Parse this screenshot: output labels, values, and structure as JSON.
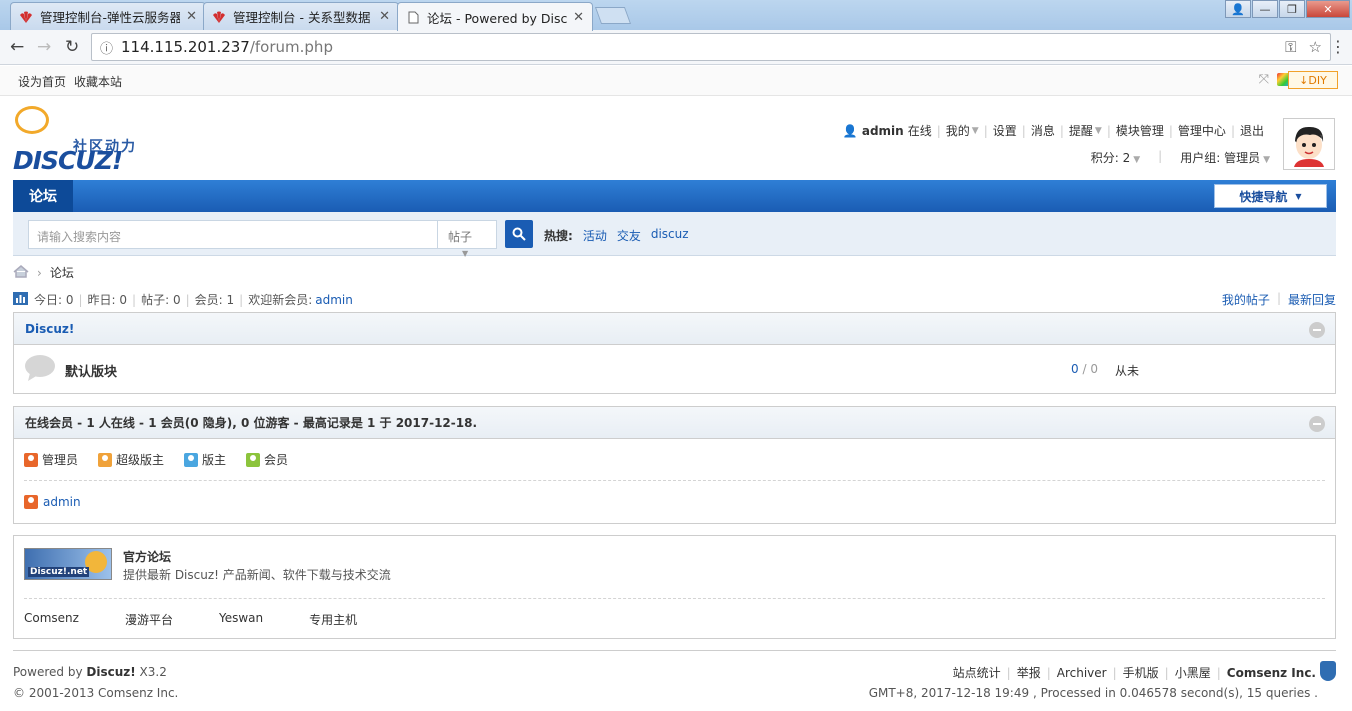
{
  "browser": {
    "tabs": [
      {
        "title": "管理控制台-弹性云服务器",
        "close": "✕"
      },
      {
        "title": "管理控制台 - 关系型数据",
        "close": "✕"
      },
      {
        "title": "论坛 - Powered by Disc",
        "close": "✕"
      }
    ],
    "url_host": "114.115.201.237",
    "url_path": "/forum.php"
  },
  "topbar": {
    "set_home": "设为首页",
    "bookmark": "收藏本站",
    "diy": "DIY"
  },
  "logo": {
    "tagline": "社区动力",
    "wordmark": "DISCUZ!"
  },
  "user": {
    "name": "admin",
    "status": "在线",
    "mine": "我的",
    "settings": "设置",
    "messages": "消息",
    "remind": "提醒",
    "module": "模块管理",
    "admin_center": "管理中心",
    "logout": "退出",
    "points": "积分: 2",
    "usergroup": "用户组: 管理员"
  },
  "nav": {
    "current": "论坛",
    "quick_nav": "快捷导航"
  },
  "search": {
    "placeholder": "请输入搜索内容",
    "type": "帖子",
    "hot_label": "热搜:",
    "hot": [
      "活动",
      "交友",
      "discuz"
    ]
  },
  "crumb": {
    "current": "论坛"
  },
  "stats": {
    "today": "今日: 0",
    "yesterday": "昨日: 0",
    "posts": "帖子: 0",
    "members": "会员: 1",
    "welcome": "欢迎新会员: ",
    "newest": "admin",
    "my_posts": "我的帖子",
    "latest_reply": "最新回复"
  },
  "category": {
    "title": "Discuz!",
    "forum_name": "默认版块",
    "threads": "0",
    "posts": "0",
    "last_post": "从未"
  },
  "online": {
    "title": "在线会员 - 1 人在线 - 1 会员(0 隐身), 0 位游客 - 最高记录是 1 于 2017-12-18.",
    "legend": [
      "管理员",
      "超级版主",
      "版主",
      "会员"
    ],
    "legend_colors": [
      "#e8662a",
      "#f0a23a",
      "#4aa6e0",
      "#8cc43c"
    ],
    "users": [
      "admin"
    ]
  },
  "links": {
    "banner_text": "Discuz!.net",
    "title": "官方论坛",
    "desc": "提供最新 Discuz! 产品新闻、软件下载与技术交流",
    "friends": [
      "Comsenz",
      "漫游平台",
      "Yeswan",
      "专用主机"
    ]
  },
  "footer": {
    "powered_pre": "Powered by ",
    "powered_brand": "Discuz!",
    "powered_ver": " X3.2",
    "copyright": "© 2001-2013 Comsenz Inc.",
    "links": [
      "站点统计",
      "举报",
      "Archiver",
      "手机版",
      "小黑屋"
    ],
    "company": "Comsenz Inc.",
    "debug": "GMT+8, 2017-12-18 19:49 , Processed in 0.046578 second(s), 15 queries ."
  }
}
